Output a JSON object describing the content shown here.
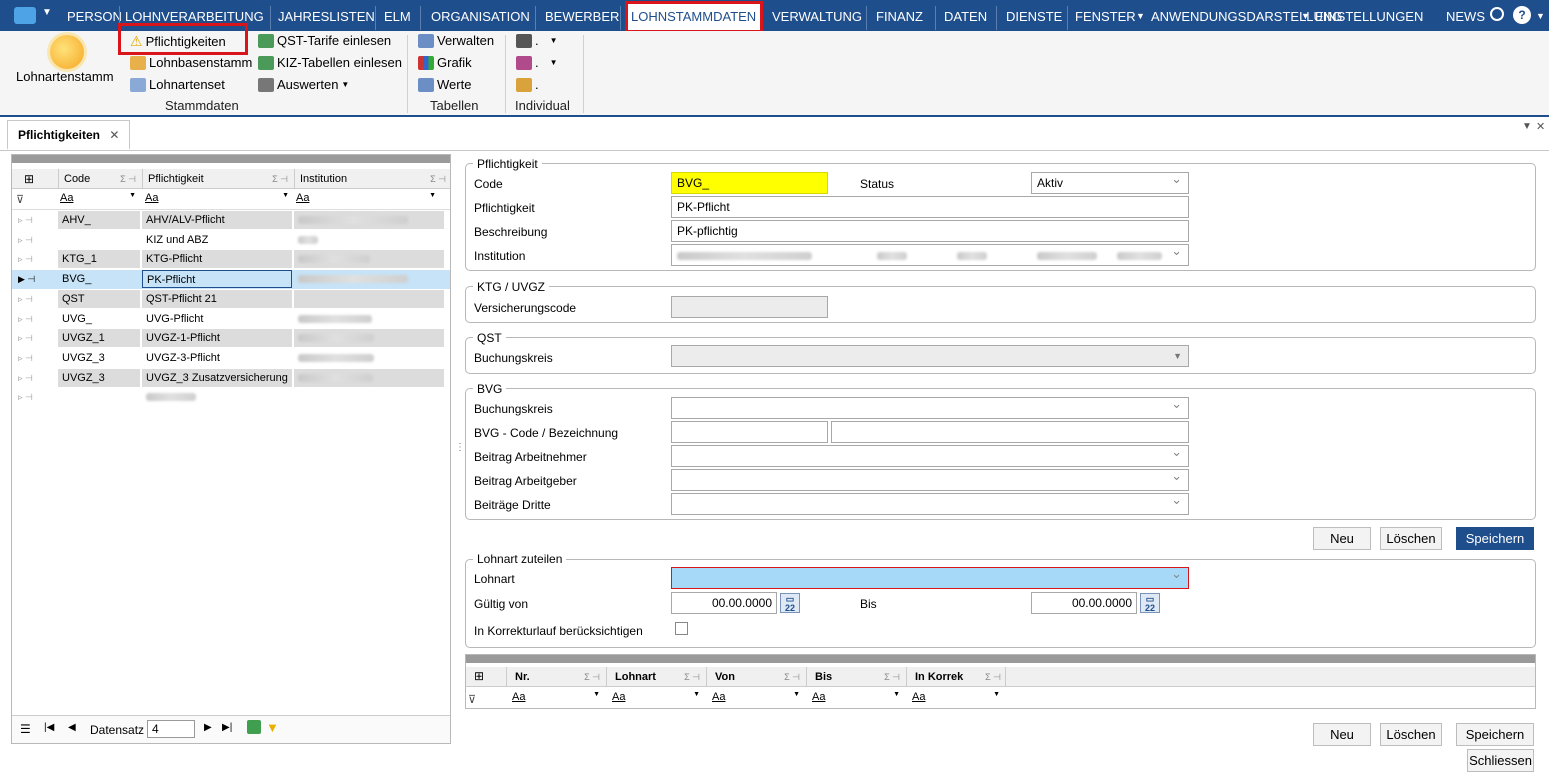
{
  "menu": {
    "items": [
      "PERSON",
      "LOHNVERARBEITUNG",
      "JAHRESLISTEN",
      "ELM",
      "ORGANISATION",
      "BEWERBER",
      "LOHNSTAMMDATEN",
      "VERWALTUNG",
      "FINANZ",
      "DATEN",
      "DIENSTE",
      "FENSTER",
      "ANWENDUNGSDARSTELLUNG",
      "EINSTELLUNGEN",
      "NEWS"
    ]
  },
  "ribbon": {
    "lohnartenstamm": "Lohnartenstamm",
    "pflichtigkeiten": "Pflichtigkeiten",
    "lohnbasenstamm": "Lohnbasenstamm",
    "lohnartenset": "Lohnartenset",
    "stammdaten": "Stammdaten",
    "qst_tarife": "QST-Tarife einlesen",
    "kiz_tabellen": "KIZ-Tabellen einlesen",
    "auswerten": "Auswerten",
    "verwalten": "Verwalten",
    "grafik": "Grafik",
    "werte": "Werte",
    "tabellen": "Tabellen",
    "individual": "Individual"
  },
  "tab": {
    "label": "Pflichtigkeiten"
  },
  "grid": {
    "headers": [
      "Code",
      "Pflichtigkeit",
      "Institution"
    ],
    "filter": "Aa",
    "rows": [
      {
        "code": "AHV_",
        "name": "AHV/ALV-Pflicht"
      },
      {
        "code": "",
        "name": "KIZ und ABZ"
      },
      {
        "code": "KTG_1",
        "name": "KTG-Pflicht"
      },
      {
        "code": "BVG_",
        "name": "PK-Pflicht"
      },
      {
        "code": "QST",
        "name": "QST-Pflicht 21"
      },
      {
        "code": "UVG_",
        "name": "UVG-Pflicht"
      },
      {
        "code": "UVGZ_1",
        "name": "UVGZ-1-Pflicht"
      },
      {
        "code": "UVGZ_3",
        "name": "UVGZ-3-Pflicht"
      },
      {
        "code": "UVGZ_3",
        "name": "UVGZ_3 Zusatzversicherung"
      },
      {
        "code": "",
        "name": ""
      }
    ],
    "footer": {
      "label": "Datensatz",
      "value": "4"
    }
  },
  "form": {
    "pflichtigkeit": {
      "legend": "Pflichtigkeit",
      "code_label": "Code",
      "code_value": "BVG_",
      "status_label": "Status",
      "status_value": "Aktiv",
      "pfl_label": "Pflichtigkeit",
      "pfl_value": "PK-Pflicht",
      "besch_label": "Beschreibung",
      "besch_value": "PK-pflichtig",
      "inst_label": "Institution"
    },
    "ktg": {
      "legend": "KTG / UVGZ",
      "vers_label": "Versicherungscode"
    },
    "qst": {
      "legend": "QST",
      "buch_label": "Buchungskreis"
    },
    "bvg": {
      "legend": "BVG",
      "buch_label": "Buchungskreis",
      "code_label": "BVG - Code / Bezeichnung",
      "an_label": "Beitrag Arbeitnehmer",
      "ag_label": "Beitrag Arbeitgeber",
      "dritte_label": "Beiträge Dritte"
    },
    "buttons": {
      "neu": "Neu",
      "loeschen": "Löschen",
      "speichern": "Speichern",
      "schliessen": "Schliessen"
    },
    "lohnart": {
      "legend": "Lohnart zuteilen",
      "lohnart_label": "Lohnart",
      "gueltig_label": "Gültig von",
      "gueltig_value": "00.00.0000",
      "bis_label": "Bis",
      "bis_value": "00.00.0000",
      "korrektur_label": "In Korrekturlauf berücksichtigen"
    },
    "subgrid": {
      "headers": [
        "Nr.",
        "Lohnart",
        "Von",
        "Bis",
        "In Korrek"
      ],
      "filter": "Aa"
    }
  },
  "colors": {
    "menubar": "#1f4e8c",
    "highlight": "#d9141b",
    "code_field": "#ffff00",
    "selected_row": "#c6e3f7",
    "lohnart_field": "#a6d8f7"
  }
}
